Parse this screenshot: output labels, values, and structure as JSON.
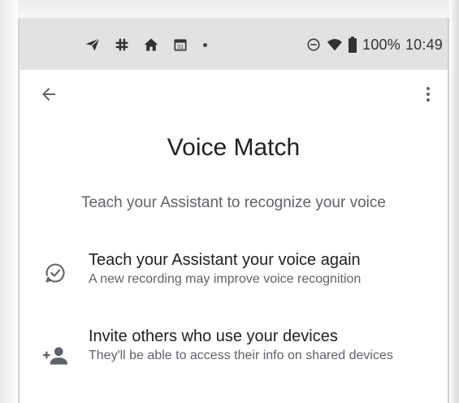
{
  "status_bar": {
    "left_icons": [
      "telegram-icon",
      "slack-icon",
      "home-icon",
      "calendar-icon",
      "dot-icon"
    ],
    "calendar_day": "31",
    "right_icons": [
      "do-not-disturb-icon",
      "wifi-icon",
      "battery-icon"
    ],
    "battery": "100%",
    "time": "10:49"
  },
  "app_bar": {
    "back_icon": "arrow-back-icon",
    "more_icon": "more-vert-icon"
  },
  "page": {
    "title": "Voice Match",
    "subtitle": "Teach your Assistant to recognize your voice"
  },
  "items": [
    {
      "icon": "voice-check-icon",
      "title": "Teach your Assistant your voice again",
      "description": "A new recording may improve voice recognition"
    },
    {
      "icon": "person-add-icon",
      "title": "Invite others who use your devices",
      "description": "They'll be able to access their info on shared devices"
    }
  ]
}
